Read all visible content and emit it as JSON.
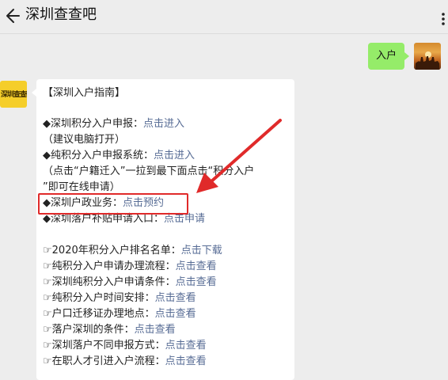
{
  "header": {
    "title": "深圳查查吧"
  },
  "user_message": "入户",
  "bot_avatar_text": "深圳查查吧",
  "bot_message": {
    "lines": [
      {
        "pre": "【深圳入户指南】"
      },
      {
        "pre": "◆深圳积分入户申报：",
        "link": "点击进入"
      },
      {
        "pre": "（建议电脑打开）"
      },
      {
        "pre": "◆纯积分入户申报系统：",
        "link": "点击进入"
      },
      {
        "pre": "（点击“户籍迁入”一拉到最下面点击“积分入户"
      },
      {
        "pre": "”即可在线申请）"
      },
      {
        "pre": "◆深圳户政业务：",
        "link": "点击预约"
      },
      {
        "pre": "◆深圳落户补贴申请入口：",
        "link": "点击申请"
      },
      {
        "pre": "☞2020年积分入户排名名单：",
        "link": "点击下载"
      },
      {
        "pre": "☞纯积分入户申请办理流程：",
        "link": "点击查看"
      },
      {
        "pre": "☞深圳纯积分入户申请条件：",
        "link": "点击查看"
      },
      {
        "pre": "☞纯积分入户时间安排：",
        "link": "点击查看"
      },
      {
        "pre": "☞户口迁移证办理地点：",
        "link": "点击查看"
      },
      {
        "pre": "☞落户深圳的条件：",
        "link": "点击查看"
      },
      {
        "pre": "☞深圳落户不同申报方式：",
        "link": "点击查看"
      },
      {
        "pre": "☞在职人才引进入户流程：",
        "link": "点击查看"
      }
    ]
  },
  "colors": {
    "bubble_me": "#95ec69",
    "link": "#566b94",
    "highlight": "#e02a2a",
    "background": "#ededed"
  },
  "icons": {
    "back": "back-arrow-icon",
    "more": "more-dots-icon",
    "annotation": "red-arrow-icon"
  }
}
